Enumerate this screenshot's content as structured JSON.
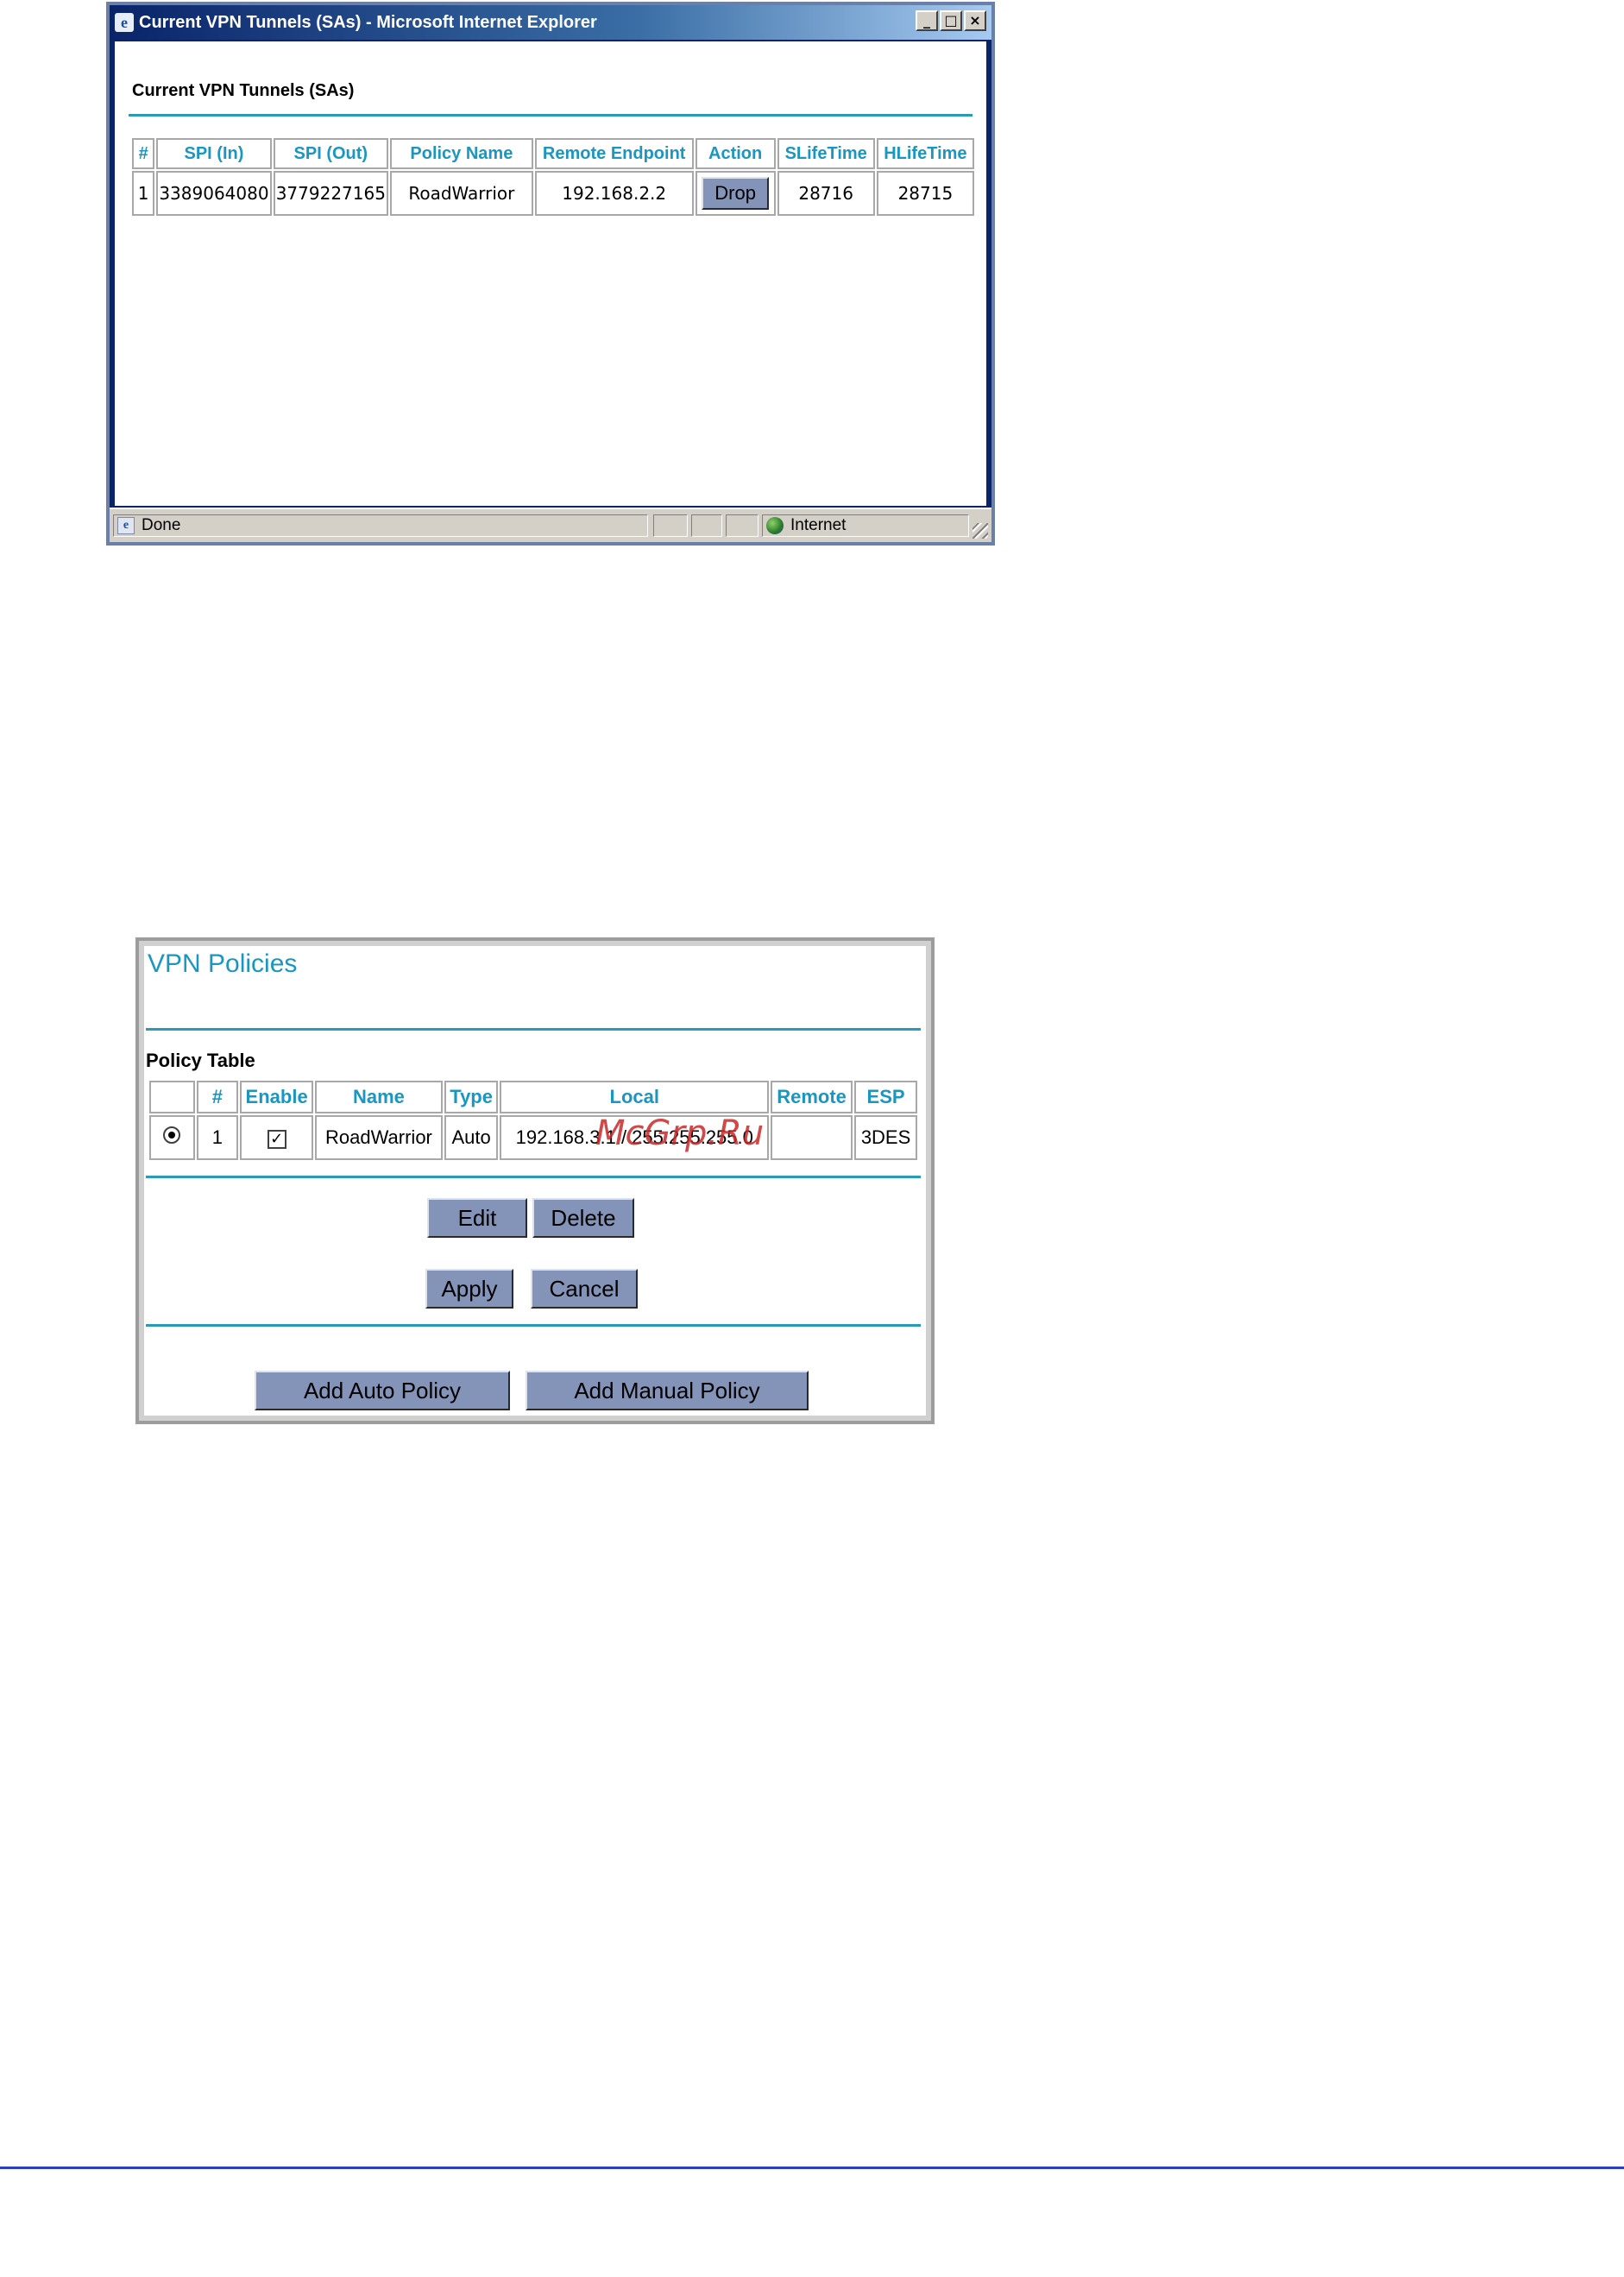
{
  "ie_window": {
    "title": "Current VPN Tunnels (SAs) - Microsoft Internet Explorer",
    "controls": [
      "_",
      "□",
      "×"
    ],
    "status_text": "Done",
    "zone_text": "Internet"
  },
  "sa_page": {
    "heading": "Current VPN Tunnels (SAs)",
    "columns": [
      "#",
      "SPI (In)",
      "SPI (Out)",
      "Policy Name",
      "Remote Endpoint",
      "Action",
      "SLifeTime",
      "HLifeTime"
    ],
    "rows": [
      {
        "num": "1",
        "spi_in": "3389064080",
        "spi_out": "3779227165",
        "policy_name": "RoadWarrior",
        "remote_endpoint": "192.168.2.2",
        "action": "Drop",
        "slifetime": "28716",
        "hlifetime": "28715"
      }
    ]
  },
  "vpn_policies": {
    "title": "VPN Policies",
    "table_heading": "Policy Table",
    "columns": [
      "",
      "#",
      "Enable",
      "Name",
      "Type",
      "Local",
      "Remote",
      "ESP"
    ],
    "rows": [
      {
        "selected": true,
        "num": "1",
        "enabled": true,
        "name": "RoadWarrior",
        "type": "Auto",
        "local": "192.168.3.1 / 255.255.255.0",
        "remote": "",
        "esp": "3DES"
      }
    ],
    "buttons": {
      "edit": "Edit",
      "delete": "Delete",
      "apply": "Apply",
      "cancel": "Cancel",
      "add_auto": "Add Auto Policy",
      "add_manual": "Add Manual Policy"
    }
  },
  "watermark": "McGrp.Ru",
  "colors": {
    "accent": "#1a96c0",
    "rule": "#2a9ab8",
    "button": "#8494b8",
    "titlebar": "#0a246a",
    "footer_rule": "#2b3fc4"
  }
}
